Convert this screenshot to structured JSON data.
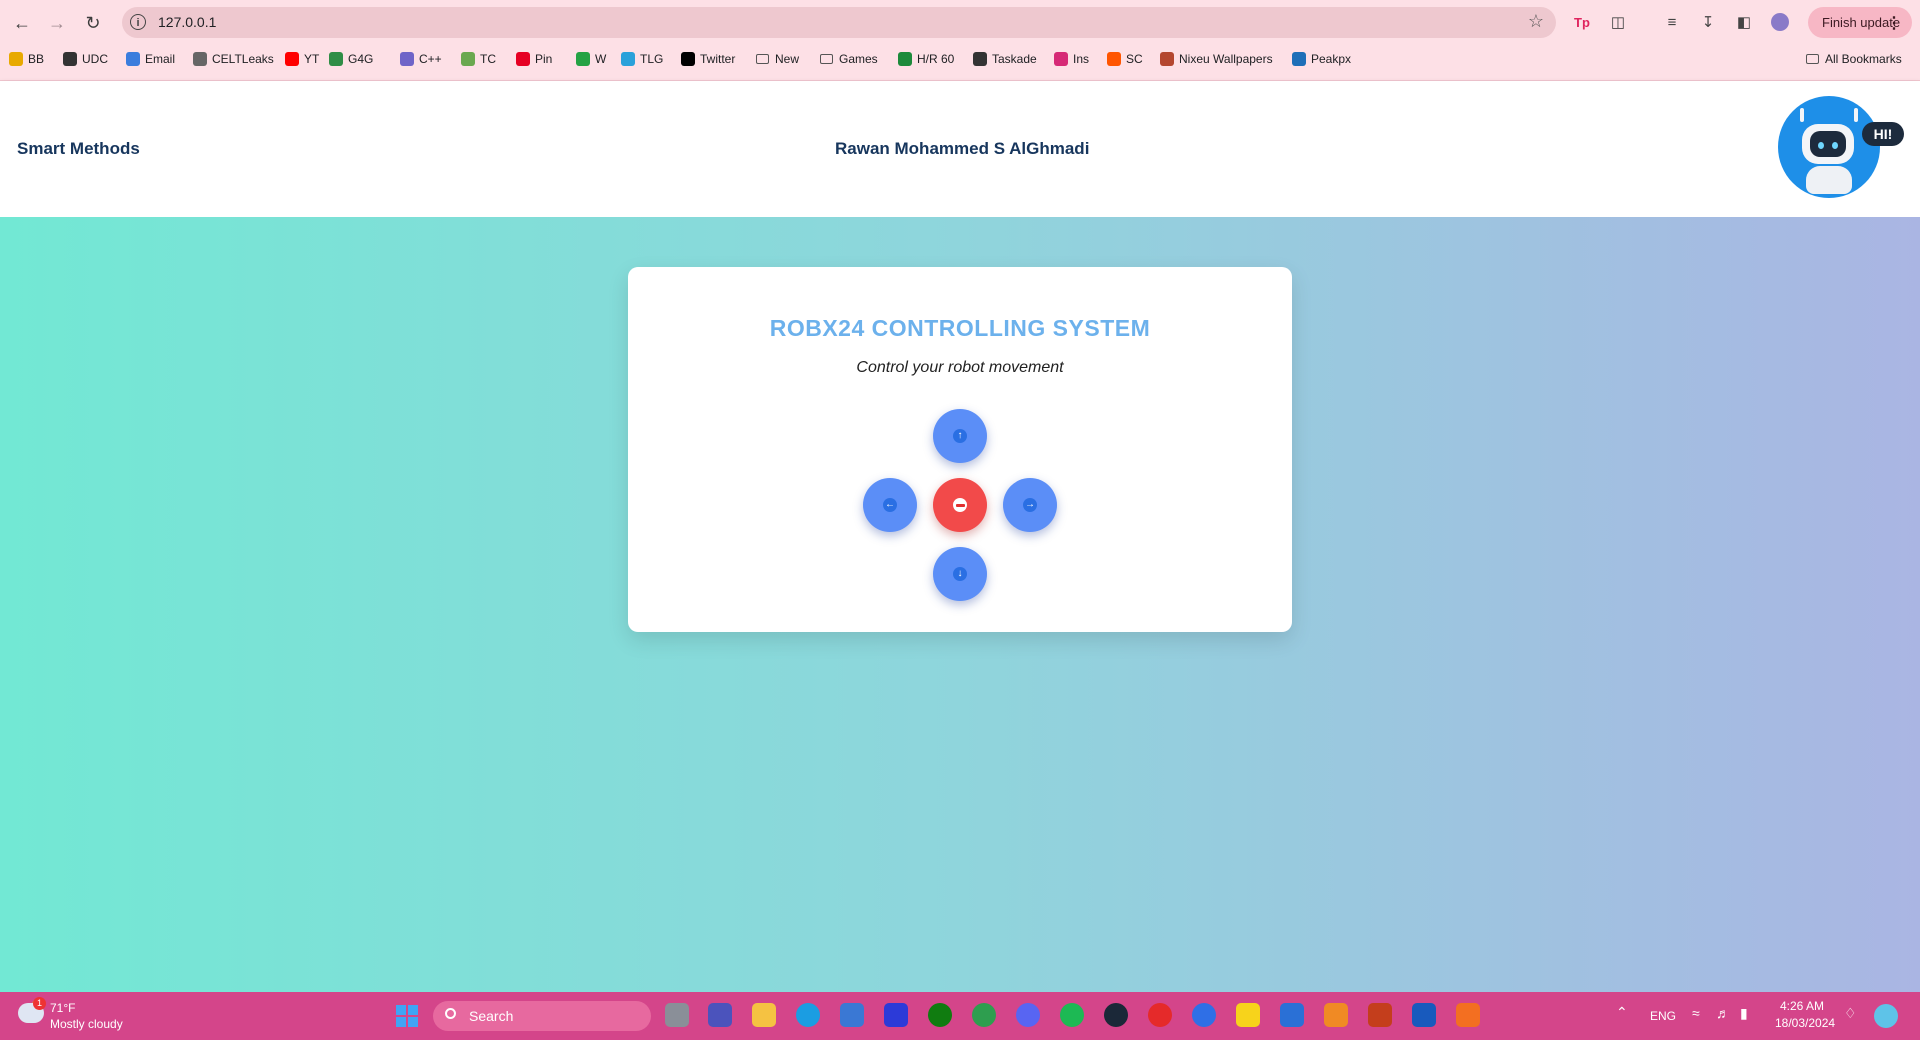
{
  "browser": {
    "url": "127.0.0.1",
    "finish_update_label": "Finish update",
    "bookmarks": [
      {
        "label": "BB",
        "color": "#e8a900"
      },
      {
        "label": "UDC",
        "color": "#333333"
      },
      {
        "label": "Email",
        "color": "#3b7ddd"
      },
      {
        "label": "CELTLeaks",
        "color": "#666666"
      },
      {
        "label": "YT",
        "color": "#ff0000"
      },
      {
        "label": "G4G",
        "color": "#2f8d46"
      },
      {
        "label": "C++",
        "color": "#6f64c8"
      },
      {
        "label": "TC",
        "color": "#6aa84f"
      },
      {
        "label": "Pin",
        "color": "#e60023"
      },
      {
        "label": "W",
        "color": "#25a244"
      },
      {
        "label": "TLG",
        "color": "#2aa1da"
      },
      {
        "label": "Twitter",
        "color": "#000000"
      },
      {
        "label": "New",
        "color": "folder"
      },
      {
        "label": "Games",
        "color": "folder"
      },
      {
        "label": "H/R 60",
        "color": "#1d8a3b"
      },
      {
        "label": "Taskade",
        "color": "#333333"
      },
      {
        "label": "Ins",
        "color": "#d62976"
      },
      {
        "label": "SC",
        "color": "#ff5500"
      },
      {
        "label": "Nixeu Wallpapers",
        "color": "#b4462f"
      },
      {
        "label": "Peakpx",
        "color": "#1e6fb8"
      }
    ],
    "all_bookmarks_label": "All Bookmarks"
  },
  "header": {
    "brand": "Smart Methods",
    "student_name": "Rawan Mohammed S AlGhmadi",
    "bot_bubble": "HI!"
  },
  "card": {
    "title": "ROBX24 CONTROLLING SYSTEM",
    "subtitle": "Control your robot movement",
    "controls": {
      "forward": "↑",
      "left": "←",
      "stop": "stop",
      "right": "→",
      "backward": "↓"
    }
  },
  "taskbar": {
    "weather_badge": "1",
    "temperature": "71°F",
    "condition": "Mostly cloudy",
    "search_label": "Search",
    "language": "ENG",
    "time": "4:26 AM",
    "date": "18/03/2024"
  },
  "colors": {
    "accent_blue": "#5b8ef7",
    "stop_red": "#f24a4a",
    "title_blue": "#6cb1ec",
    "taskbar": "#d4458a",
    "chrome": "#fde0e6"
  }
}
